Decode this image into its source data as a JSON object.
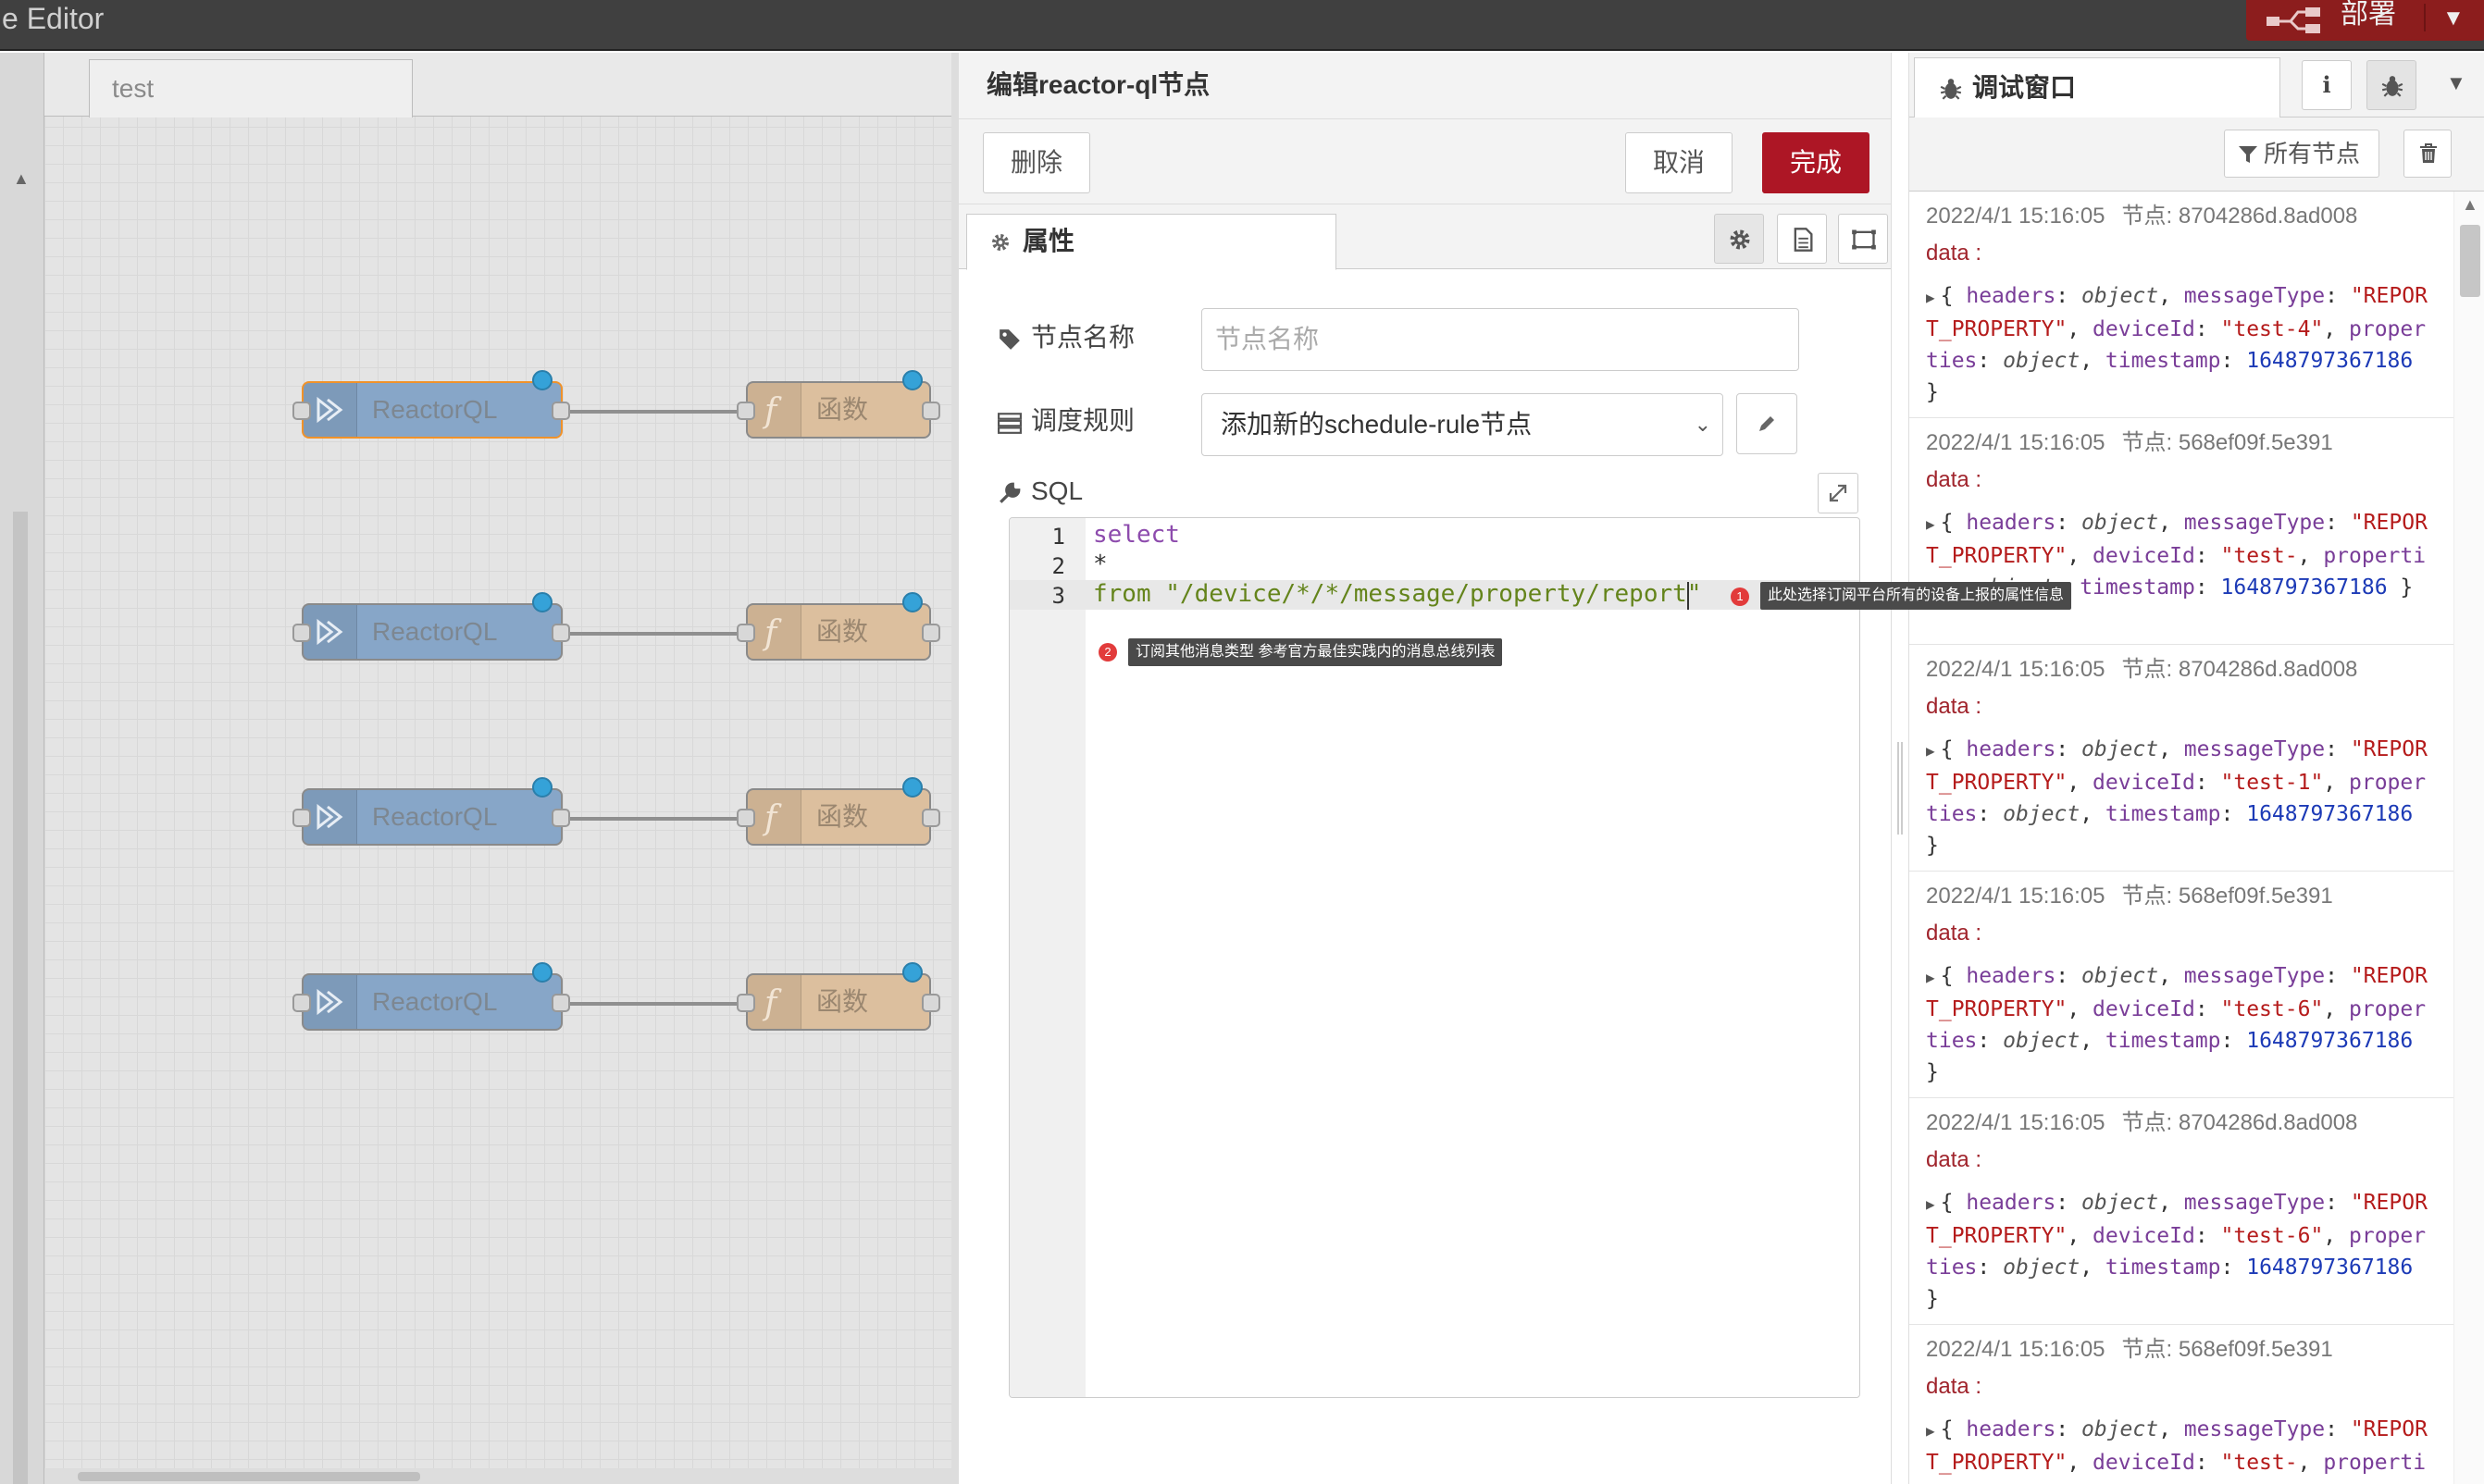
{
  "header": {
    "title": "e Editor",
    "deploy_label": "部署"
  },
  "workspace": {
    "tab_label": "test",
    "nodes": [
      {
        "type": "reactorql",
        "label": "ReactorQL",
        "selected": true
      },
      {
        "type": "function",
        "label": "函数"
      },
      {
        "type": "reactorql",
        "label": "ReactorQL"
      },
      {
        "type": "function",
        "label": "函数"
      },
      {
        "type": "reactorql",
        "label": "ReactorQL"
      },
      {
        "type": "function",
        "label": "函数"
      },
      {
        "type": "reactorql",
        "label": "ReactorQL"
      },
      {
        "type": "function",
        "label": "函数"
      }
    ]
  },
  "tray": {
    "title": "编辑reactor-ql节点",
    "delete_label": "删除",
    "cancel_label": "取消",
    "done_label": "完成",
    "tab_label": "属性",
    "name_label": "节点名称",
    "name_placeholder": "节点名称",
    "name_value": "",
    "schedule_label": "调度规则",
    "schedule_value": "添加新的schedule-rule节点",
    "sql_label": "SQL",
    "code_lines": [
      "select",
      "*",
      "from \"/device/*/*/message/property/report\""
    ],
    "annotations": [
      {
        "num": "1",
        "text": "此处选择订阅平台所有的设备上报的属性信息"
      },
      {
        "num": "2",
        "text": "订阅其他消息类型 参考官方最佳实践内的消息总线列表"
      }
    ]
  },
  "sidebar": {
    "tab_label": "调试窗口",
    "info_label": "i",
    "filter_label": "所有节点",
    "messages": [
      {
        "date": "2022/4/1 15:16:05",
        "node": "节点: 8704286d.8ad008",
        "topic": "data :",
        "deviceId": "\"test-4\"",
        "timestamp": "1648797367186"
      },
      {
        "date": "2022/4/1 15:16:05",
        "node": "节点: 568ef09f.5e391",
        "topic": "data :",
        "deviceId": "\"test-",
        "timestamp": "1648797367186"
      },
      {
        "date": "2022/4/1 15:16:05",
        "node": "节点: 8704286d.8ad008",
        "topic": "data :",
        "deviceId": "\"test-1\"",
        "timestamp": "1648797367186"
      },
      {
        "date": "2022/4/1 15:16:05",
        "node": "节点: 568ef09f.5e391",
        "topic": "data :",
        "deviceId": "\"test-6\"",
        "timestamp": "1648797367186"
      },
      {
        "date": "2022/4/1 15:16:05",
        "node": "节点: 8704286d.8ad008",
        "topic": "data :",
        "deviceId": "\"test-6\"",
        "timestamp": "1648797367186"
      },
      {
        "date": "2022/4/1 15:16:05",
        "node": "节点: 568ef09f.5e391",
        "topic": "data :",
        "deviceId": "\"test-",
        "timestamp": ""
      }
    ],
    "body_parts": {
      "open": "{",
      "headers_key": "headers",
      "object_type": "object",
      "msgtype_key": "messageType",
      "msgtype_value": "\"REPORT_PROPERTY\"",
      "deviceid_key": "deviceId",
      "properties_key": "properties",
      "timestamp_key": "timestamp",
      "close": "}"
    }
  }
}
